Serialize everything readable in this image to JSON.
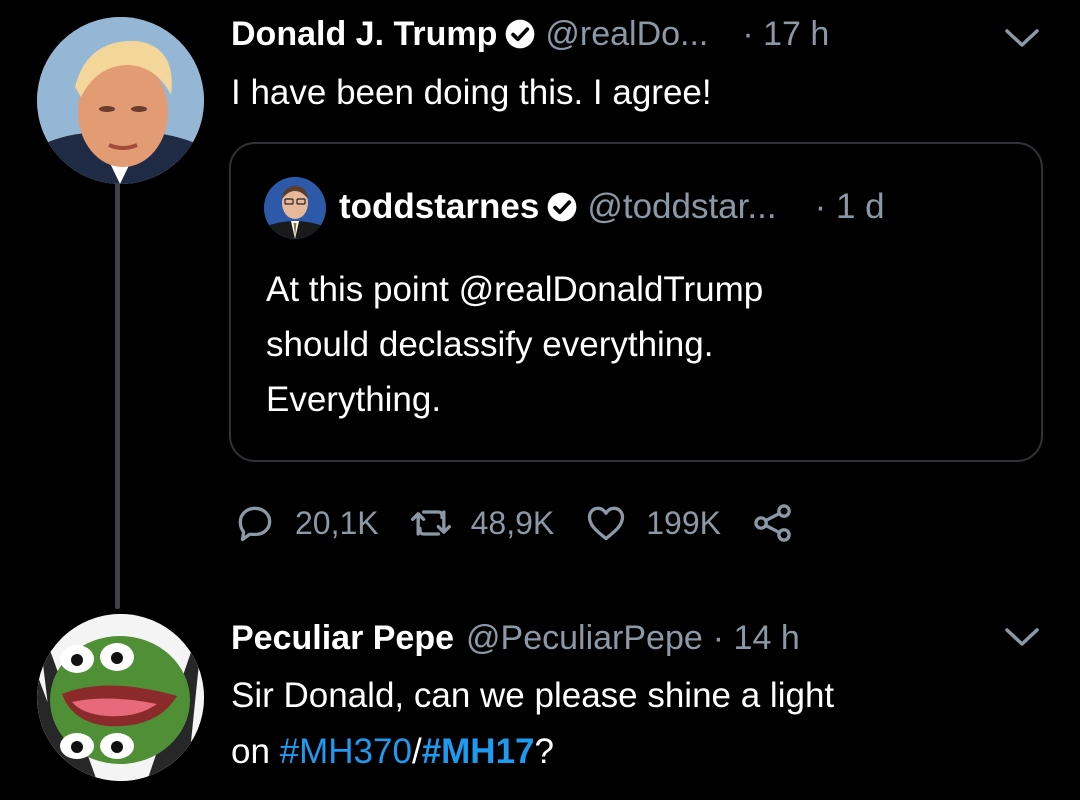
{
  "tweet": {
    "author_name": "Donald J. Trump",
    "handle": "@realDo...",
    "time": "· 17 h",
    "text": "I have been doing this. I agree!",
    "avatar": "trump-portrait"
  },
  "quoted": {
    "author_name": "toddstarnes",
    "handle": "@toddstar...",
    "time": "· 1 d",
    "lines": [
      "At this point @realDonaldTrump",
      "should declassify everything.",
      "Everything."
    ]
  },
  "actions": {
    "reply_count": "20,1K",
    "retweet_count": "48,9K",
    "like_count": "199K",
    "icons": [
      "reply-icon",
      "retweet-icon",
      "like-icon",
      "share-icon"
    ]
  },
  "reply": {
    "author_name": "Peculiar Pepe",
    "handle": "@PeculiarPepe",
    "time": "· 14 h",
    "line1": "Sir Donald, can we please shine a light",
    "line2_prefix": "on ",
    "hashtag1": "#MH370",
    "separator": "/",
    "hashtag2": "#MH17",
    "suffix": "?",
    "avatar": "pepe-frog"
  },
  "colors": {
    "background": "#000000",
    "text": "#ffffff",
    "secondary": "#8b98a5",
    "accent": "#1d9bf0",
    "border": "#2f3336"
  }
}
